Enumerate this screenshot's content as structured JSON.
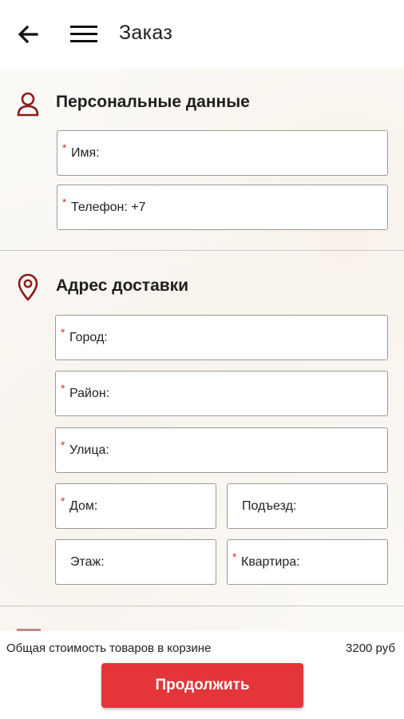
{
  "header": {
    "title": "Заказ",
    "back_icon": "arrow-left-icon",
    "menu_icon": "hamburger-menu-icon"
  },
  "personal": {
    "title": "Персональные данные",
    "icon": "user-icon",
    "fields": {
      "name": {
        "label": "Имя:",
        "required": true
      },
      "phone": {
        "label": "Телефон: +7",
        "required": true
      }
    }
  },
  "address": {
    "title": "Адрес доставки",
    "icon": "location-pin-icon",
    "fields": {
      "city": {
        "label": "Город:",
        "required": true
      },
      "district": {
        "label": "Район:",
        "required": true
      },
      "street": {
        "label": "Улица:",
        "required": true
      },
      "house": {
        "label": "Дом:",
        "required": true
      },
      "entrance": {
        "label": "Подъезд:",
        "required": false
      },
      "floor": {
        "label": "Этаж:",
        "required": false
      },
      "apartment": {
        "label": "Квартира:",
        "required": true
      }
    }
  },
  "required_mark": "*",
  "footer": {
    "total_label": "Общая стоимость товаров в корзине",
    "total_value": "3200 руб",
    "continue_label": "Продолжить"
  },
  "colors": {
    "accent": "#e3353a",
    "icon": "#8b1a1a",
    "required": "#d8332f"
  }
}
